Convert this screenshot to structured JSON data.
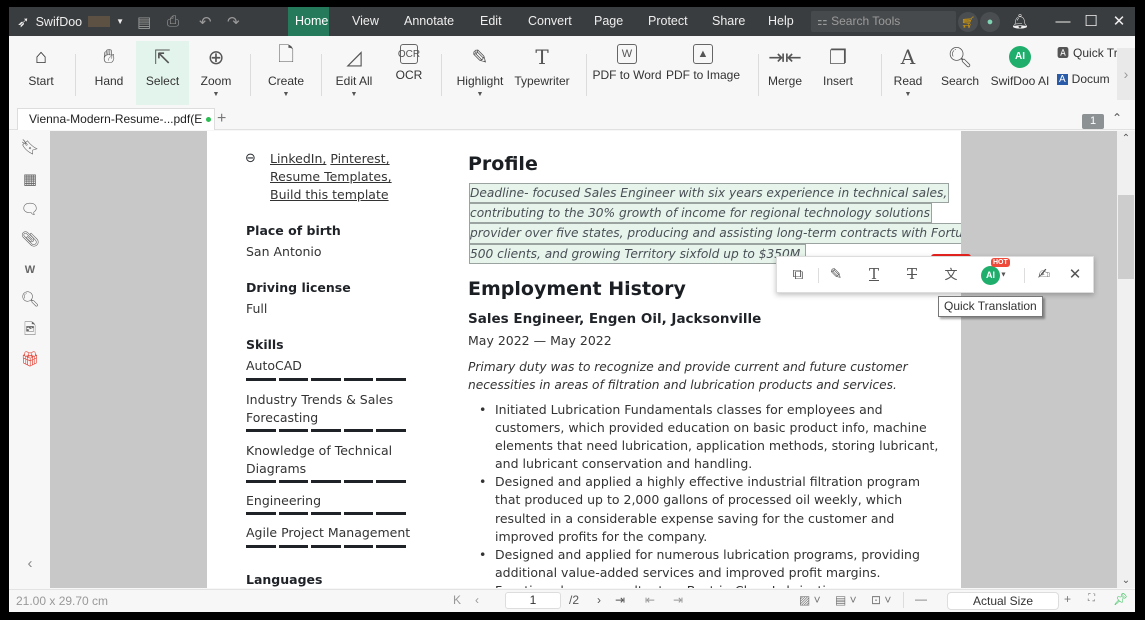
{
  "app": {
    "name": "SwifDoo",
    "menus": [
      "Home",
      "View",
      "Annotate",
      "Edit",
      "Convert",
      "Page",
      "Protect",
      "Share",
      "Help"
    ],
    "active_menu": "Home",
    "search_placeholder": "Search Tools",
    "icons": {
      "logo": "swifdoo-bird-logo",
      "save": "save-icon",
      "print": "print-icon",
      "undo": "undo-icon",
      "redo": "redo-icon",
      "cart": "cart-icon",
      "account": "account-icon",
      "bell": "bell-icon"
    }
  },
  "ribbon": {
    "buttons": [
      {
        "label": "Start",
        "icon": "home-icon"
      },
      {
        "label": "Hand",
        "icon": "hand-icon"
      },
      {
        "label": "Select",
        "icon": "cursor-icon",
        "selected": true
      },
      {
        "label": "Zoom",
        "icon": "zoom-in-icon",
        "dropdown": true
      },
      {
        "label": "Create",
        "icon": "create-file-icon",
        "dropdown": true
      },
      {
        "label": "Edit All",
        "icon": "edit-icon",
        "dropdown": true
      },
      {
        "label": "OCR",
        "icon": "ocr-icon"
      },
      {
        "label": "Highlight",
        "icon": "highlight-icon",
        "dropdown": true
      },
      {
        "label": "Typewriter",
        "icon": "typewriter-icon"
      },
      {
        "label": "PDF to Word",
        "icon": "pdf-to-word-icon"
      },
      {
        "label": "PDF to Image",
        "icon": "pdf-to-image-icon"
      },
      {
        "label": "Merge",
        "icon": "merge-icon"
      },
      {
        "label": "Insert",
        "icon": "insert-page-icon"
      },
      {
        "label": "Read",
        "icon": "read-aloud-icon",
        "dropdown": true
      },
      {
        "label": "Search",
        "icon": "search-doc-icon"
      },
      {
        "label": "SwifDoo AI",
        "icon": "ai-icon"
      }
    ],
    "small_buttons": [
      {
        "label": "Quick Tr",
        "icon": "quick-translate-icon"
      },
      {
        "label": "Docum",
        "icon": "document-translate-icon"
      }
    ]
  },
  "tabs": {
    "doc_tab": "Vienna-Modern-Resume-...pdf(E",
    "page_badge": "1"
  },
  "sidebar_icons": [
    "bookmark-icon",
    "thumbnails-icon",
    "comments-icon",
    "attachment-icon",
    "word-icon",
    "search-icon",
    "signature-icon",
    "gift-icon"
  ],
  "document": {
    "left": {
      "links": [
        "LinkedIn,",
        "Pinterest,",
        "Resume Templates,",
        "Build this template"
      ],
      "place_of_birth_label": "Place of birth",
      "place_of_birth": "San Antonio",
      "driving_license_label": "Driving license",
      "driving_license": "Full",
      "skills_label": "Skills",
      "skills": [
        {
          "name": "AutoCAD",
          "level": 5,
          "max": 5
        },
        {
          "name": "Industry Trends & Sales Forecasting",
          "level": 5,
          "max": 5
        },
        {
          "name": "Knowledge of Technical Diagrams",
          "level": 5,
          "max": 5
        },
        {
          "name": "Engineering",
          "level": 5,
          "max": 5
        },
        {
          "name": "Agile Project Management",
          "level": 5,
          "max": 5
        }
      ],
      "languages_label": "Languages"
    },
    "right": {
      "profile_heading": "Profile",
      "profile_lines": [
        "Deadline- focused Sales Engineer with six years experience in technical sales,",
        "contributing to the 30% growth of income for regional technology solutions",
        "provider over five states, producing and assisting long-term contracts with Fortune",
        "500 clients, and growing Territory sixfold up to $350M."
      ],
      "employment_heading": "Employment History",
      "job_title": "Sales Engineer, Engen Oil, Jacksonville",
      "job_dates": "May 2022 — May 2022",
      "job_summary": "Primary duty was to recognize and provide current and future customer necessities in areas of filtration and lubrication products and services.",
      "bullets": [
        "Initiated Lubrication Fundamentals classes for employees and customers, which provided education on basic product info, machine elements that need lubrication, application methods, storing lubricant, and lubricant conservation and handling.",
        "Designed and applied a highly effective industrial filtration program that produced up to 2,000 gallons of processed oil weekly, which resulted in a considerable expense saving for the customer and improved profits for the company.",
        "Designed and applied for numerous lubrication programs, providing additional value-added services and improved profit margins.",
        "Functioned as a consultant on Best-in-Class Lubrication programs."
      ]
    }
  },
  "float_toolbar": {
    "items": [
      "copy-icon",
      "highlight-icon",
      "underline-icon",
      "strikethrough-icon",
      "quick-translation-icon",
      "ai-assistant-icon",
      "edit-note-icon",
      "close-icon"
    ],
    "ai_badge": "HOT",
    "ai_label": "AI",
    "tooltip": "Quick Translation"
  },
  "status": {
    "page_size": "21.00 x 29.70 cm",
    "current_page": "1",
    "total_pages": "/2",
    "zoom": "Actual Size"
  },
  "colors": {
    "accent": "#267a5c",
    "highlight_bg": "#e6f4ec",
    "callout_red": "#e8231f",
    "ai_green": "#1fae6c"
  }
}
